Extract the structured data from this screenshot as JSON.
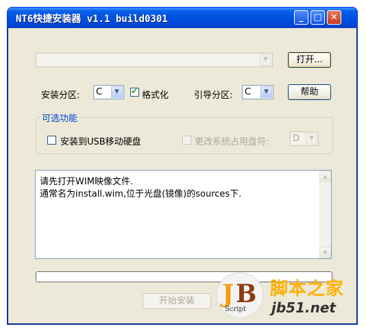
{
  "window": {
    "title": "NT6快捷安装器 v1.1 build0301"
  },
  "titlebar_buttons": {
    "minimize": "_",
    "maximize": "□",
    "close": "✕"
  },
  "top": {
    "wim_path_value": "",
    "open_button": "打开..."
  },
  "row2": {
    "install_partition_label": "安装分区:",
    "install_partition_value": "C",
    "format_label": "格式化",
    "format_checked": true,
    "boot_partition_label": "引导分区:",
    "boot_partition_value": "C",
    "help_button": "帮助"
  },
  "optional": {
    "group_title": "可选功能",
    "usb_label": "安装到USB移动硬盘",
    "usb_checked": false,
    "change_drive_label": "更改系统占用盘符:",
    "drive_value": "D"
  },
  "message": {
    "line1": "请先打开WIM映像文件.",
    "line2": "通常名为install.wim,位于光盘(镜像)的sources下."
  },
  "progress": {
    "value": 0
  },
  "start_button": "开始安装",
  "watermark": {
    "logo_letters": "JB",
    "script": "Script",
    "cn": "脚本之家",
    "domain": "jb51.net"
  }
}
